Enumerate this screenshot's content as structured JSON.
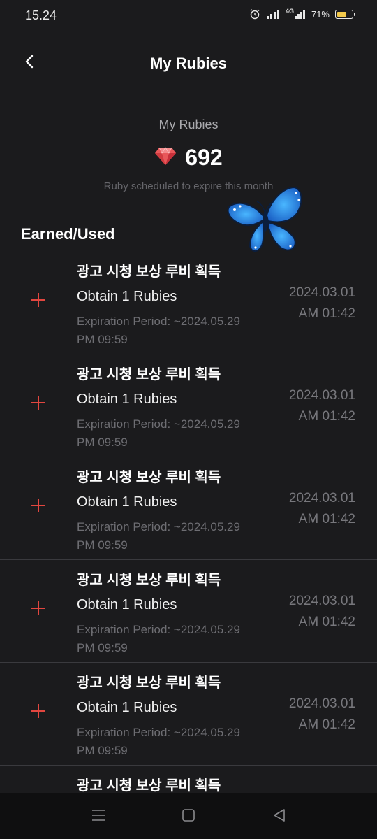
{
  "status_bar": {
    "time": "15.24",
    "network": "4G",
    "battery": "71%",
    "battery_level": 0.71,
    "icons": [
      "alarm-icon",
      "signal-icon",
      "signal-4g-icon",
      "battery-icon"
    ]
  },
  "header": {
    "title": "My Rubies",
    "back_icon": "chevron-left-icon"
  },
  "summary": {
    "label": "My Rubies",
    "balance": "692",
    "icon": "ruby-gem-icon",
    "expire_note": "Ruby scheduled to expire this month"
  },
  "section": {
    "title": "Earned/Used"
  },
  "history": [
    {
      "title": "광고 시청 보상 루비 획득",
      "amount": "Obtain 1 Rubies",
      "expiry_line1": "Expiration Period: ~2024.05.29",
      "expiry_line2": "PM 09:59",
      "date": "2024.03.01",
      "time": "AM 01:42"
    },
    {
      "title": "광고 시청 보상 루비 획득",
      "amount": "Obtain 1 Rubies",
      "expiry_line1": "Expiration Period: ~2024.05.29",
      "expiry_line2": "PM 09:59",
      "date": "2024.03.01",
      "time": "AM 01:42"
    },
    {
      "title": "광고 시청 보상 루비 획득",
      "amount": "Obtain 1 Rubies",
      "expiry_line1": "Expiration Period: ~2024.05.29",
      "expiry_line2": "PM 09:59",
      "date": "2024.03.01",
      "time": "AM 01:42"
    },
    {
      "title": "광고 시청 보상 루비 획득",
      "amount": "Obtain 1 Rubies",
      "expiry_line1": "Expiration Period: ~2024.05.29",
      "expiry_line2": "PM 09:59",
      "date": "2024.03.01",
      "time": "AM 01:42"
    },
    {
      "title": "광고 시청 보상 루비 획득",
      "amount": "Obtain 1 Rubies",
      "expiry_line1": "Expiration Period: ~2024.05.29",
      "expiry_line2": "PM 09:59",
      "date": "2024.03.01",
      "time": "AM 01:42"
    },
    {
      "title": "광고 시청 보상 루비 획득",
      "amount": "",
      "expiry_line1": "",
      "expiry_line2": "",
      "date": "",
      "time": ""
    }
  ],
  "colors": {
    "background": "#1b1b1d",
    "plus": "#e2463f",
    "ruby": "#e8585a",
    "divider": "#3a3a3e"
  },
  "nav_bar": {
    "icons": [
      "recent-apps-icon",
      "home-icon",
      "back-triangle-icon"
    ]
  }
}
